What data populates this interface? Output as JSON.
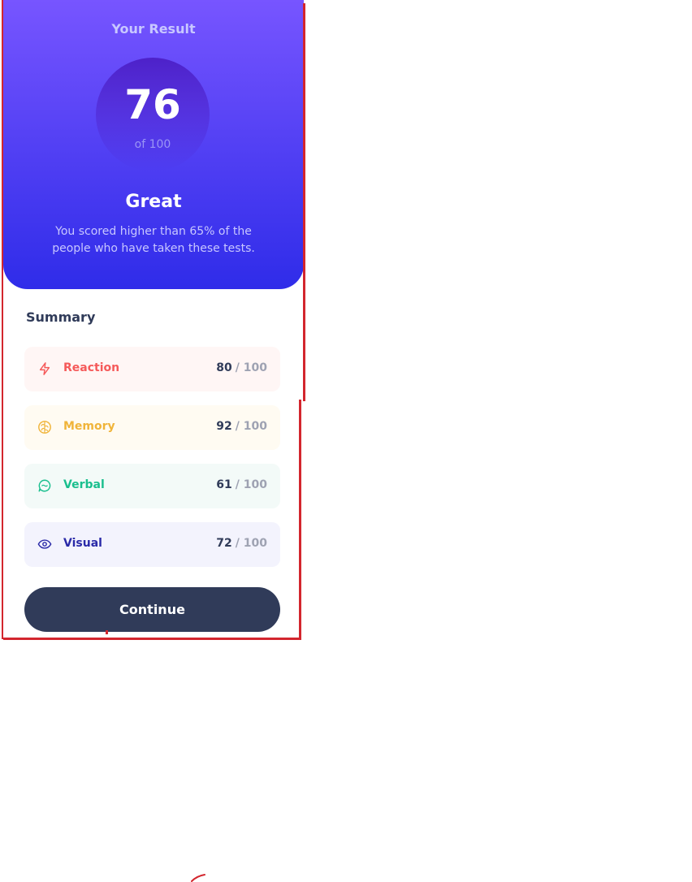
{
  "result": {
    "title": "Your Result",
    "score": "76",
    "out_of": "of 100",
    "rating": "Great",
    "message": "You scored higher than 65% of the people who have taken these tests."
  },
  "summary": {
    "title": "Summary",
    "items": [
      {
        "label": "Reaction",
        "score": "80",
        "max": "/ 100",
        "icon": "lightning-icon",
        "color": "#f55a5a",
        "bg": "#fff6f5"
      },
      {
        "label": "Memory",
        "score": "92",
        "max": "/ 100",
        "icon": "brain-icon",
        "color": "#f0b43a",
        "bg": "#fffbf2"
      },
      {
        "label": "Verbal",
        "score": "61",
        "max": "/ 100",
        "icon": "chat-bubble-icon",
        "color": "#1abf8e",
        "bg": "#f3faf8"
      },
      {
        "label": "Visual",
        "score": "72",
        "max": "/ 100",
        "icon": "eye-icon",
        "color": "#2a2aa8",
        "bg": "#f3f3fd"
      }
    ]
  },
  "actions": {
    "continue_label": "Continue"
  },
  "colors": {
    "gradient_top": "#7755ff",
    "gradient_bottom": "#2f2ce9",
    "dark_navy": "#303b59",
    "annotation_red": "#d3262e"
  }
}
